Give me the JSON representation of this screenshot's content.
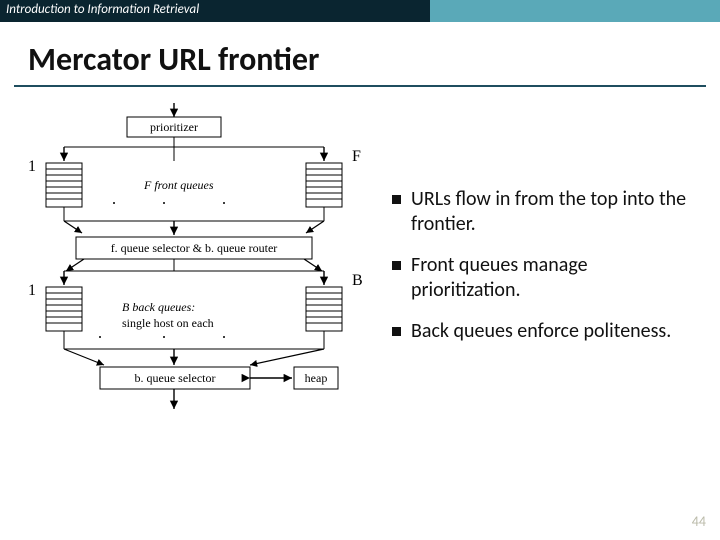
{
  "header": {
    "course_title": "Introduction to Information Retrieval"
  },
  "slide": {
    "title": "Mercator URL frontier",
    "page_number": "44"
  },
  "diagram": {
    "boxes": {
      "prioritizer": "prioritizer",
      "selector_router": "f. queue selector & b. queue router",
      "bqueue_selector": "b. queue selector",
      "heap": "heap"
    },
    "labels": {
      "front_left_num": "1",
      "front_right_letter": "F",
      "front_queues": "F front queues",
      "back_left_num": "1",
      "back_right_letter": "B",
      "back_queues1": "B back queues:",
      "back_queues2": "single host on each"
    }
  },
  "bullets": [
    "URLs flow in from the top into the frontier.",
    "Front queues manage prioritization.",
    "Back queues enforce politeness."
  ]
}
